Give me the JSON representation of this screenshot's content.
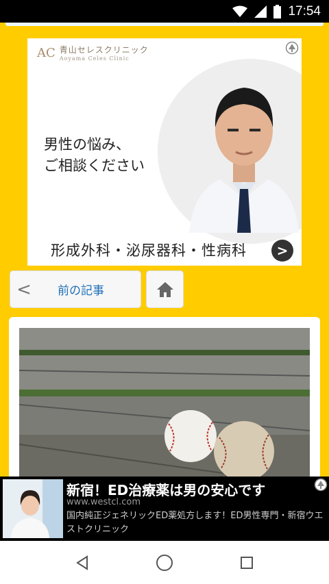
{
  "status_bar": {
    "time": "17:54",
    "icons": [
      "wifi-icon",
      "signal-icon",
      "battery-icon"
    ]
  },
  "ad_banner": {
    "logo_mark": "AC",
    "logo_name": "青山セレスクリニック",
    "logo_sub": "Aoyama Celes Clinic",
    "headline_line1": "男性の悩み、",
    "headline_line2": "ご相談ください",
    "footer": "形成外科・泌尿器科・性病科",
    "arrow": ">"
  },
  "navigation": {
    "prev_chevron": "<",
    "prev_label": "前の記事",
    "home_icon": "home-icon"
  },
  "bottom_ad": {
    "title": "新宿！ED治療薬は男の安心です",
    "url": "www.westcl.com",
    "description": "国内純正ジェネリックED薬処方します！ED男性専門・新宿ウエストクリニック"
  },
  "colors": {
    "background": "#ffcc00",
    "link": "#1f6fb8"
  }
}
